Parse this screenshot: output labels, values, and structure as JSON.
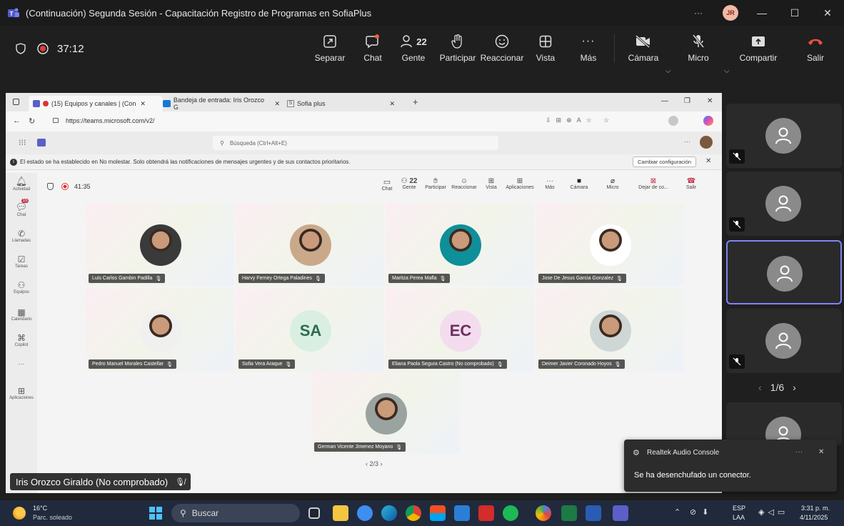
{
  "window": {
    "title": "(Continuación) Segunda Sesión - Capacitación Registro de Programas en SofiaPlus",
    "more": "···",
    "user_initials": "JR",
    "min": "—",
    "max": "☐",
    "close": "✕"
  },
  "meeting": {
    "timer": "37:12",
    "toolbar": {
      "separar": "Separar",
      "chat": "Chat",
      "gente": "Gente",
      "gente_count": "22",
      "participar": "Participar",
      "reaccionar": "Reaccionar",
      "vista": "Vista",
      "mas": "Más",
      "camara": "Cámara",
      "micro": "Micro",
      "compartir": "Compartir",
      "salir": "Salir"
    }
  },
  "browser": {
    "tabs": [
      "(15) Equipos y canales | (Con",
      "Bandeja de entrada: Iris Orozco G",
      "Sofia plus"
    ],
    "url": "https://teams.microsoft.com/v2/",
    "search_placeholder": "Búsqueda (Ctrl+Alt+E)",
    "dnd_message": "El estado se ha establecido en No molestar. Solo obtendrá las notificaciones de mensajes urgentes y de sus contactos prioritarios.",
    "dnd_button": "Cambiar configuración"
  },
  "inner": {
    "timer": "41:35",
    "toolbar": [
      "Chat",
      "Gente",
      "Participar",
      "Reaccionar",
      "Vista",
      "Aplicaciones",
      "Más",
      "Cámara",
      "Micro",
      "Dejar de co...",
      "Salir"
    ],
    "gente_count": "22",
    "rail": [
      "Actividad",
      "Chat",
      "Llamadas",
      "Tareas",
      "Equipos",
      "Calendario",
      "Copilot",
      "···",
      "Aplicaciones"
    ],
    "chat_badge": "15",
    "participants": [
      {
        "name": "Luis Carlos Gambin Padilla",
        "kind": "photo",
        "color": "#3a3a3a"
      },
      {
        "name": "Harvy Ferney Ortega Paladines",
        "kind": "photo",
        "color": "#c9a98a"
      },
      {
        "name": "Maritza Perea Mafla",
        "kind": "photo",
        "color": "#0e8f9a"
      },
      {
        "name": "Jose De Jesus Garcia Gonzalez",
        "kind": "photo",
        "color": "#ffffff"
      },
      {
        "name": "Pedro Manuel Morales Castellar",
        "kind": "photo",
        "color": "#f0f0f0"
      },
      {
        "name": "Sofia Vera Araque",
        "kind": "initials",
        "initials": "SA",
        "color": "#d8efe2",
        "text_color": "#2f6b4d"
      },
      {
        "name": "Eliana Paola Segura Castro (No comprobado)",
        "kind": "initials",
        "initials": "EC",
        "color": "#f4dcef",
        "text_color": "#6b2f5e"
      },
      {
        "name": "Deimer Javier Coronado Hoyos",
        "kind": "photo",
        "color": "#cfd6d6"
      },
      {
        "name": "German Vicente Jimenez Moyano",
        "kind": "photo",
        "color": "#9aa3a0"
      }
    ],
    "page": "2/3"
  },
  "presenter": "Iris Orozco Giraldo (No comprobado)",
  "side_pager": "1/6",
  "notification": {
    "app": "Realtek Audio Console",
    "message": "Se ha desenchufado un conector.",
    "more": "···",
    "close": "✕"
  },
  "taskbar": {
    "weather_temp": "16°C",
    "weather_desc": "Parc. soleado",
    "search": "Buscar",
    "lang1": "ESP",
    "lang2": "LAA",
    "time": "3:31 p. m.",
    "date": "4/11/2025"
  }
}
